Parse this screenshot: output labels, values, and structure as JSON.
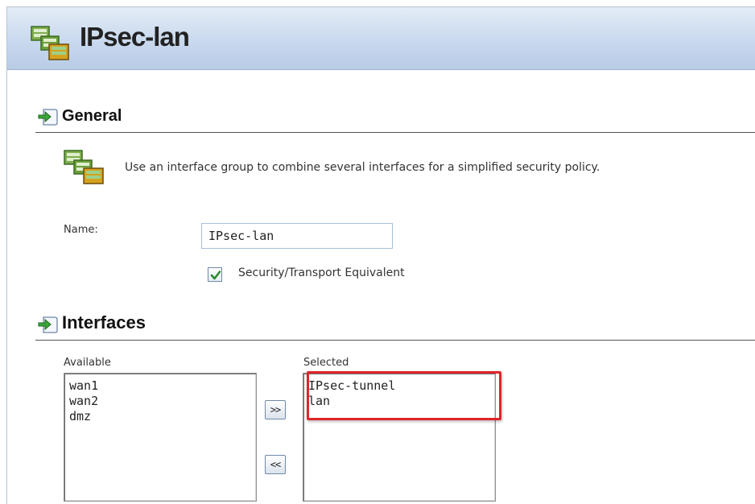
{
  "window": {
    "title": "IPsec-lan",
    "title_icon": "interface-group-icon"
  },
  "general": {
    "heading": "General",
    "heading_icon": "green-arrow-section-icon",
    "description": "Use an interface group to combine several interfaces for a simplified security policy.",
    "description_icon": "interface-group-icon",
    "name_label": "Name:",
    "name_value": "IPsec-lan",
    "security_checkbox": {
      "label": "Security/Transport Equivalent",
      "checked": true
    }
  },
  "interfaces": {
    "heading": "Interfaces",
    "heading_icon": "green-arrow-section-icon",
    "available_label": "Available",
    "available_items": [
      "wan1",
      "wan2",
      "dmz"
    ],
    "selected_label": "Selected",
    "selected_items": [
      "IPsec-tunnel",
      "lan"
    ],
    "add_button_label": ">>",
    "remove_button_label": "<<",
    "highlight_color": "#e0262b"
  },
  "colors": {
    "title_bar_top": "#e3ecf7",
    "title_bar_bottom": "#b8cce6",
    "check_green": "#2e8b2e",
    "section_arrow_green": "#3aa53a"
  }
}
